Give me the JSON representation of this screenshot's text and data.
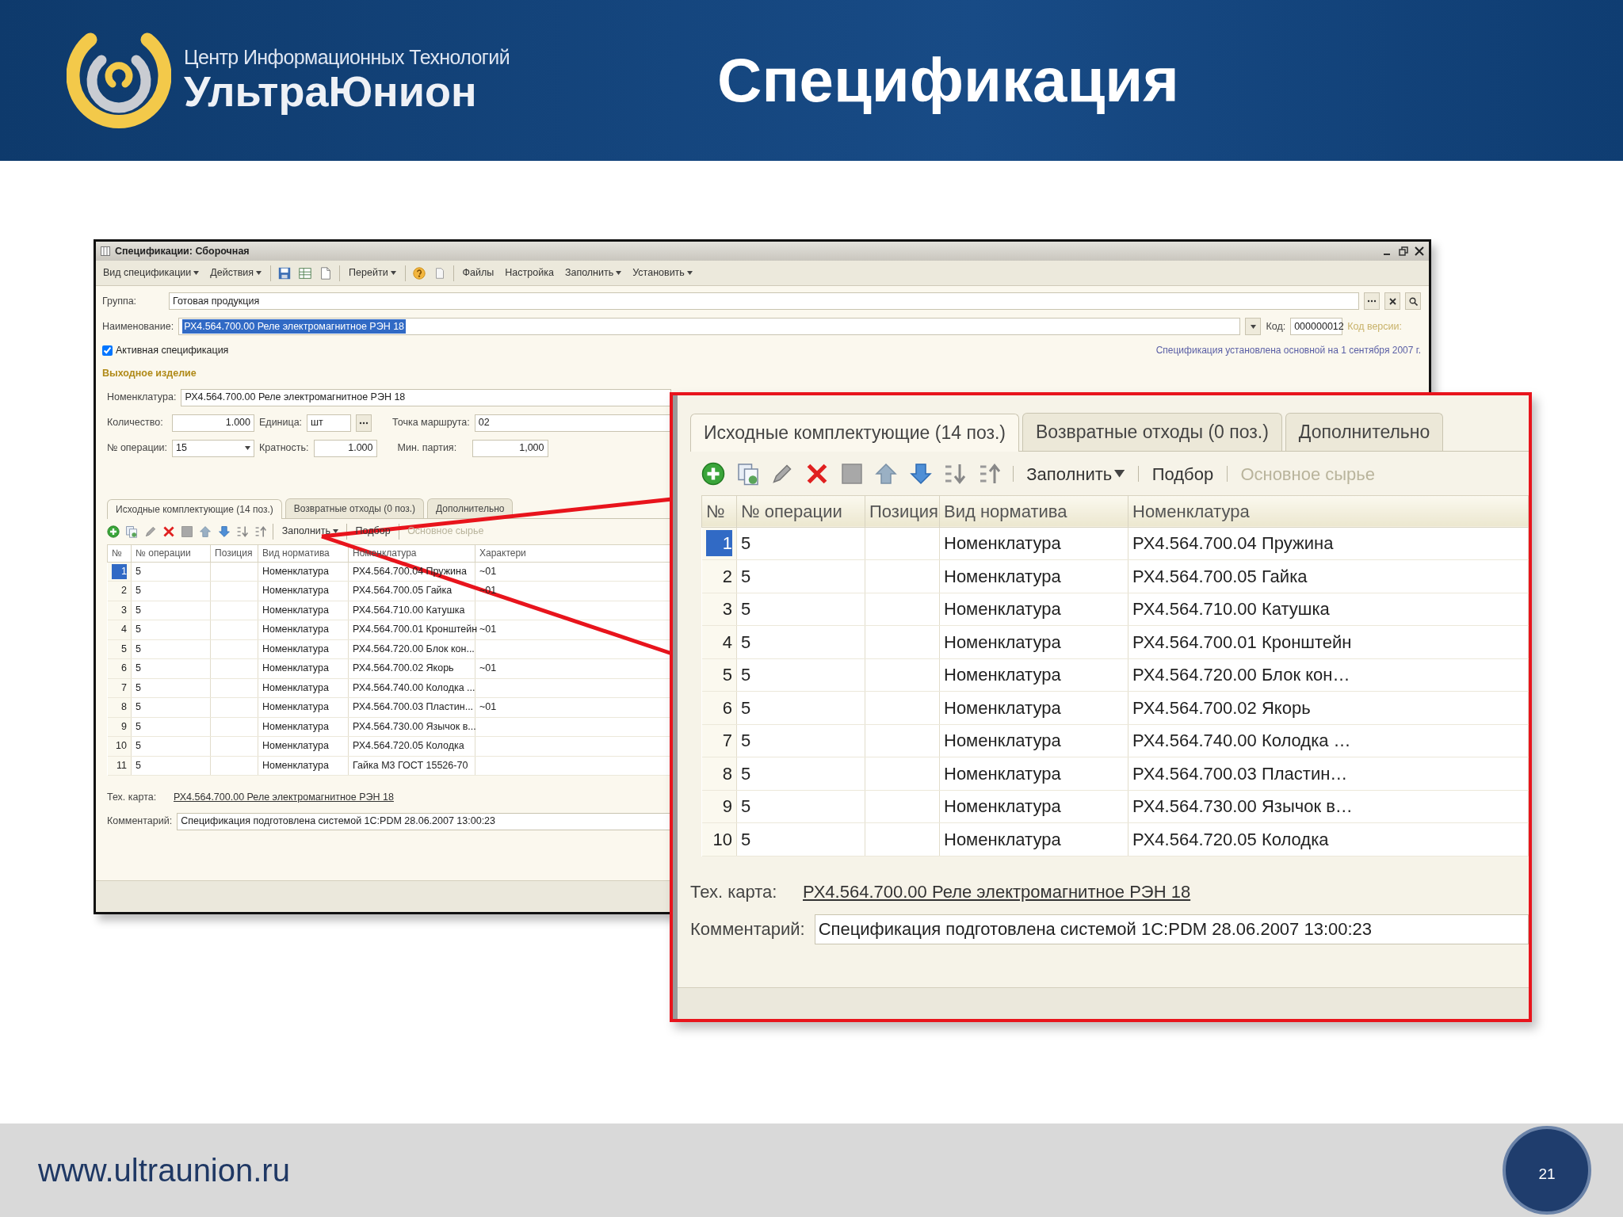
{
  "header": {
    "logo_line1": "Центр Информационных Технологий",
    "logo_line2": "УльтраЮнион",
    "title": "Спецификация"
  },
  "window": {
    "title": "Спецификации: Сборочная",
    "toolbar": [
      {
        "kind": "menu",
        "label": "Вид спецификации"
      },
      {
        "kind": "menu",
        "label": "Действия"
      },
      {
        "kind": "icon"
      },
      {
        "kind": "icon"
      },
      {
        "kind": "icon"
      },
      {
        "kind": "menu",
        "label": "Перейти"
      },
      {
        "kind": "icon"
      },
      {
        "kind": "icon"
      },
      {
        "kind": "button",
        "label": "Файлы"
      },
      {
        "kind": "button",
        "label": "Настройка"
      },
      {
        "kind": "menu",
        "label": "Заполнить"
      },
      {
        "kind": "menu",
        "label": "Установить"
      }
    ],
    "group_label": "Группа:",
    "group_value": "Готовая продукция",
    "name_label": "Наименование:",
    "name_value": "РХ4.564.700.00 Реле электромагнитное РЭН 18",
    "code_label": "Код:",
    "code_value": "000000012",
    "version_link": "Код версии:",
    "active": {
      "label": "Активная спецификация",
      "checked": true
    },
    "note": "Спецификация установлена основной на 1 сентября 2007 г.",
    "section": "Выходное изделие",
    "item_label": "Номенклатура:",
    "item_value": "РХ4.564.700.00 Реле электромагнитное РЭН 18",
    "qty_label": "Количество:",
    "qty_value": "1.000",
    "unit_label": "Единица:",
    "unit_value": "шт",
    "route_label": "Точка маршрута:",
    "route_value": "02",
    "op_label": "№ операции:",
    "op_value": "15",
    "mult_label": "Кратность:",
    "mult_value": "1.000",
    "batch_label": "Мин. партия:",
    "batch_value": "1,000",
    "tabs": [
      {
        "label": "Исходные комплектующие (14 поз.)",
        "selected": true
      },
      {
        "label": "Возвратные отходы (0 поз.)",
        "selected": false
      },
      {
        "label": "Дополнительно",
        "selected": false
      }
    ],
    "table_toolbar": [
      {
        "label": "Заполнить",
        "dropdown": true,
        "disabled": false
      },
      {
        "label": "Подбор",
        "dropdown": false,
        "disabled": false
      },
      {
        "label": "Основное сырье",
        "dropdown": false,
        "disabled": true
      }
    ],
    "columns": [
      "№",
      "№ операции",
      "Позиция",
      "Вид норматива",
      "Номенклатура",
      "Характери"
    ],
    "rows": [
      {
        "num": "1",
        "op": "5",
        "type": "Номенклатура",
        "item": "РХ4.564.700.04 Пружина",
        "char": "~01",
        "selected": true
      },
      {
        "num": "2",
        "op": "5",
        "type": "Номенклатура",
        "item": "РХ4.564.700.05 Гайка",
        "char": "~01",
        "selected": false
      },
      {
        "num": "3",
        "op": "5",
        "type": "Номенклатура",
        "item": "РХ4.564.710.00 Катушка",
        "selected": false
      },
      {
        "num": "4",
        "op": "5",
        "type": "Номенклатура",
        "item": "РХ4.564.700.01 Кронштейн",
        "char": "~01",
        "selected": false
      },
      {
        "num": "5",
        "op": "5",
        "type": "Номенклатура",
        "item": "РХ4.564.720.00 Блок кон...",
        "selected": false
      },
      {
        "num": "6",
        "op": "5",
        "type": "Номенклатура",
        "item": "РХ4.564.700.02 Якорь",
        "char": "~01",
        "selected": false
      },
      {
        "num": "7",
        "op": "5",
        "type": "Номенклатура",
        "item": "РХ4.564.740.00 Колодка ...",
        "selected": false
      },
      {
        "num": "8",
        "op": "5",
        "type": "Номенклатура",
        "item": "РХ4.564.700.03 Пластин...",
        "char": "~01",
        "selected": false
      },
      {
        "num": "9",
        "op": "5",
        "type": "Номенклатура",
        "item": "РХ4.564.730.00 Язычок в...",
        "selected": false
      },
      {
        "num": "10",
        "op": "5",
        "type": "Номенклатура",
        "item": "РХ4.564.720.05 Колодка",
        "selected": false
      },
      {
        "num": "11",
        "op": "5",
        "type": "Номенклатура",
        "item": "Гайка М3 ГОСТ 15526-70",
        "selected": false
      }
    ],
    "tech_label": "Тех. карта:",
    "tech_link": "РХ4.564.700.00 Реле электромагнитное РЭН 18",
    "comment_label": "Комментарий:",
    "comment_value": "Спецификация подготовлена системой 1С:PDM 28.06.2007 13:00:23"
  },
  "zoom": {
    "tabs": [
      {
        "label": "Исходные комплектующие (14 поз.)",
        "selected": true
      },
      {
        "label": "Возвратные отходы (0 поз.)",
        "selected": false
      },
      {
        "label": "Дополнительно",
        "selected": false
      }
    ],
    "table_toolbar": [
      {
        "label": "Заполнить",
        "dropdown": true,
        "disabled": false
      },
      {
        "label": "Подбор",
        "dropdown": false,
        "disabled": false
      },
      {
        "label": "Основное сырье",
        "dropdown": false,
        "disabled": true
      }
    ],
    "columns": [
      "№",
      "№ операции",
      "Позиция",
      "Вид норматива",
      "Номенклатура"
    ],
    "rows": [
      {
        "num": "1",
        "op": "5",
        "type": "Номенклатура",
        "item": "РХ4.564.700.04 Пружина",
        "selected": true
      },
      {
        "num": "2",
        "op": "5",
        "type": "Номенклатура",
        "item": "РХ4.564.700.05 Гайка",
        "selected": false
      },
      {
        "num": "3",
        "op": "5",
        "type": "Номенклатура",
        "item": "РХ4.564.710.00 Катушка",
        "selected": false
      },
      {
        "num": "4",
        "op": "5",
        "type": "Номенклатура",
        "item": "РХ4.564.700.01 Кронштейн",
        "selected": false
      },
      {
        "num": "5",
        "op": "5",
        "type": "Номенклатура",
        "item": "РХ4.564.720.00 Блок кон…",
        "selected": false
      },
      {
        "num": "6",
        "op": "5",
        "type": "Номенклатура",
        "item": "РХ4.564.700.02 Якорь",
        "selected": false
      },
      {
        "num": "7",
        "op": "5",
        "type": "Номенклатура",
        "item": "РХ4.564.740.00 Колодка …",
        "selected": false
      },
      {
        "num": "8",
        "op": "5",
        "type": "Номенклатура",
        "item": "РХ4.564.700.03 Пластин…",
        "selected": false
      },
      {
        "num": "9",
        "op": "5",
        "type": "Номенклатура",
        "item": "РХ4.564.730.00 Язычок в…",
        "selected": false
      },
      {
        "num": "10",
        "op": "5",
        "type": "Номенклатура",
        "item": "РХ4.564.720.05 Колодка",
        "selected": false
      }
    ],
    "tech_label": "Тех. карта:",
    "tech_link": "РХ4.564.700.00 Реле электромагнитное РЭН 18",
    "comment_label": "Комментарий:",
    "comment_value": "Спецификация подготовлена системой 1С:PDM 28.06.2007 13:00:23"
  },
  "footer": {
    "url": "www.ultraunion.ru",
    "page": "21"
  }
}
